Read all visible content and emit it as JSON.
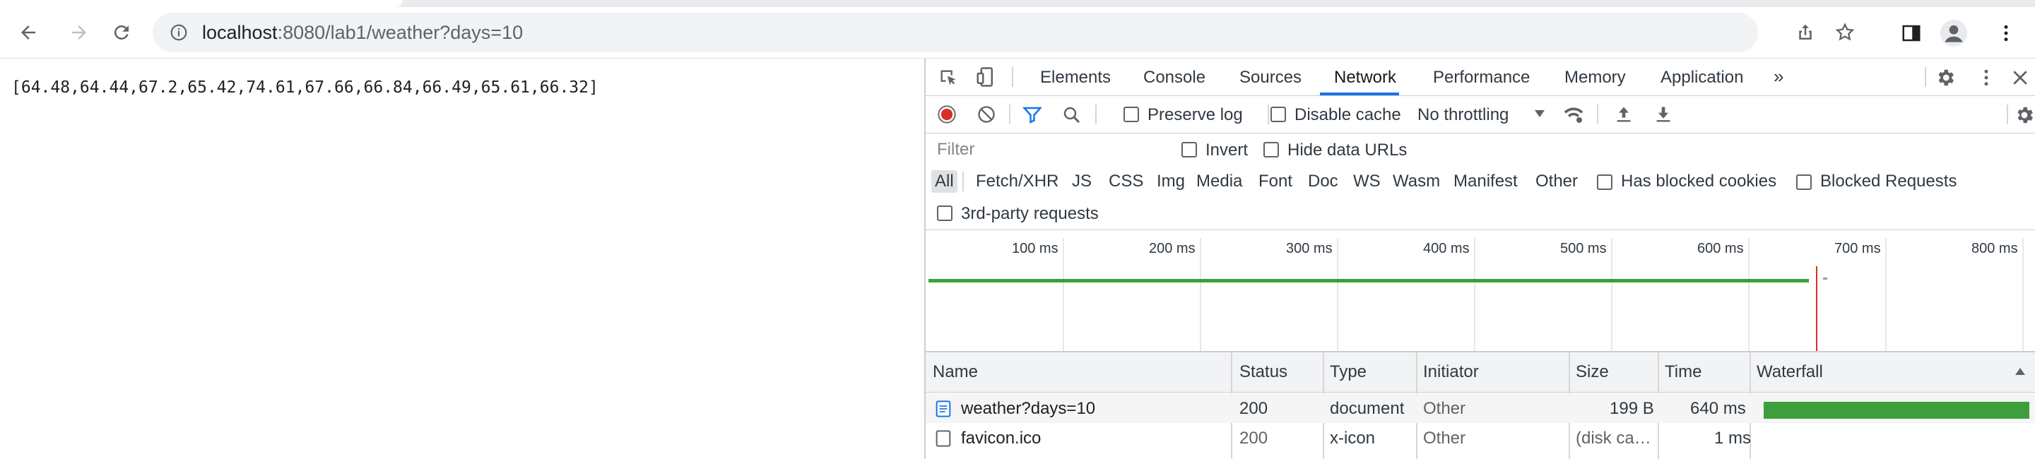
{
  "browser": {
    "url_host": "localhost",
    "url_path": ":8080/lab1/weather?days=10"
  },
  "page": {
    "json_text": "[64.48,64.44,67.2,65.42,74.61,67.66,66.84,66.49,65.61,66.32]"
  },
  "devtools": {
    "tabs": [
      "Elements",
      "Console",
      "Sources",
      "Network",
      "Performance",
      "Memory",
      "Application"
    ],
    "active_tab": "Network",
    "toolbar": {
      "preserve_log": "Preserve log",
      "disable_cache": "Disable cache",
      "throttling": "No throttling"
    },
    "filter": {
      "placeholder": "Filter",
      "invert": "Invert",
      "hide_data_urls": "Hide data URLs"
    },
    "type_filters": [
      "All",
      "Fetch/XHR",
      "JS",
      "CSS",
      "Img",
      "Media",
      "Font",
      "Doc",
      "WS",
      "Wasm",
      "Manifest",
      "Other"
    ],
    "has_blocked_cookies": "Has blocked cookies",
    "blocked_requests": "Blocked Requests",
    "third_party": "3rd-party requests",
    "timeline_ticks": [
      "100 ms",
      "200 ms",
      "300 ms",
      "400 ms",
      "500 ms",
      "600 ms",
      "700 ms",
      "800 ms"
    ],
    "table": {
      "columns": [
        "Name",
        "Status",
        "Type",
        "Initiator",
        "Size",
        "Time",
        "Waterfall"
      ],
      "rows": [
        {
          "name": "weather?days=10",
          "status": "200",
          "type": "document",
          "initiator": "Other",
          "size": "199 B",
          "time": "640 ms",
          "icon": "document-icon"
        },
        {
          "name": "favicon.ico",
          "status": "200",
          "type": "x-icon",
          "initiator": "Other",
          "size": "(disk ca…",
          "time": "1 ms",
          "icon": "file-icon"
        }
      ]
    },
    "colors": {
      "accent": "#1a73e8",
      "record": "#d93025",
      "waterfall": "#3c9f3c"
    }
  }
}
